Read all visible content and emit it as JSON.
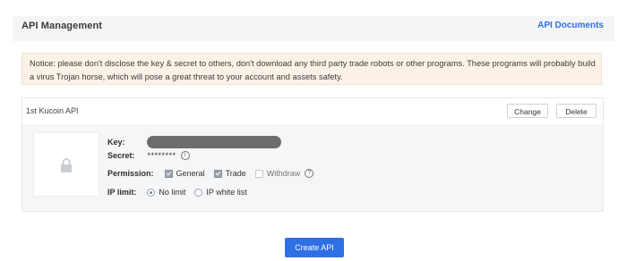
{
  "header": {
    "title": "API Management",
    "docs_link": "API Documents"
  },
  "notice": {
    "text": "Notice: please don't disclose the key & secret to others, don't download any third party trade robots or other programs. These programs will probably build a virus Trojan horse, which will pose a great threat to your account and assets safety."
  },
  "api_card": {
    "name": "1st Kucoin API",
    "change_label": "Change",
    "delete_label": "Delete",
    "key_label": "Key:",
    "secret_label": "Secret:",
    "secret_value": "********",
    "permission_label": "Permission:",
    "permissions": [
      {
        "label": "General",
        "checked": true
      },
      {
        "label": "Trade",
        "checked": true
      },
      {
        "label": "Withdraw",
        "checked": false
      }
    ],
    "ip_limit_label": "IP limit:",
    "ip_options": [
      {
        "label": "No limit",
        "selected": true
      },
      {
        "label": "IP white list",
        "selected": false
      }
    ]
  },
  "create_button": "Create API",
  "colors": {
    "accent": "#2f6fe4",
    "notice_bg": "#fbf1e6",
    "panel_bg": "#f5f6f8"
  }
}
